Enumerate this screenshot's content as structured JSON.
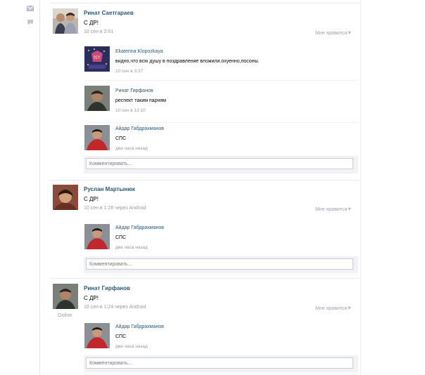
{
  "posts": [
    {
      "author": "Ринат Саетгараев",
      "text": "С ДР!",
      "meta": "10 сен в 2:01",
      "like_label": "Мне нравится",
      "online": "",
      "replies": [
        {
          "author": "Ekaterina Klopozkaya",
          "text": "видно,что всю душу в поздравление вложили.охуенно,посоны.",
          "meta": "10 сен в 3:37"
        },
        {
          "author": "Ринат Гирфанов",
          "text": "респект таким парням",
          "meta": "10 сен в 13:10"
        },
        {
          "author": "Айдар Габдрахманов",
          "text": "СПС",
          "meta": "два часа назад"
        }
      ],
      "comment_placeholder": "Комментировать..."
    },
    {
      "author": "Руслан Мартынюк",
      "text": "С ДР!",
      "meta": "10 сен в 1:28 через Android",
      "like_label": "Мне нравится",
      "online": "",
      "replies": [
        {
          "author": "Айдар Габдрахманов",
          "text": "СПС",
          "meta": "два часа назад"
        }
      ],
      "comment_placeholder": "Комментировать..."
    },
    {
      "author": "Ринат Гирфанов",
      "text": "С ДР!",
      "meta": "10 сен в 1:24 через Android",
      "like_label": "Мне нравится",
      "online": "Online",
      "replies": [
        {
          "author": "Айдар Габдрахманов",
          "text": "СПС",
          "meta": "два часа назад"
        }
      ],
      "comment_placeholder": "Комментировать..."
    }
  ],
  "rail": {
    "icons": [
      "mail-icon",
      "chat-bubble-icon"
    ]
  },
  "colors": {
    "link": "#2b587a",
    "meta": "#999999",
    "comment_bg": "#f0f2f5"
  }
}
